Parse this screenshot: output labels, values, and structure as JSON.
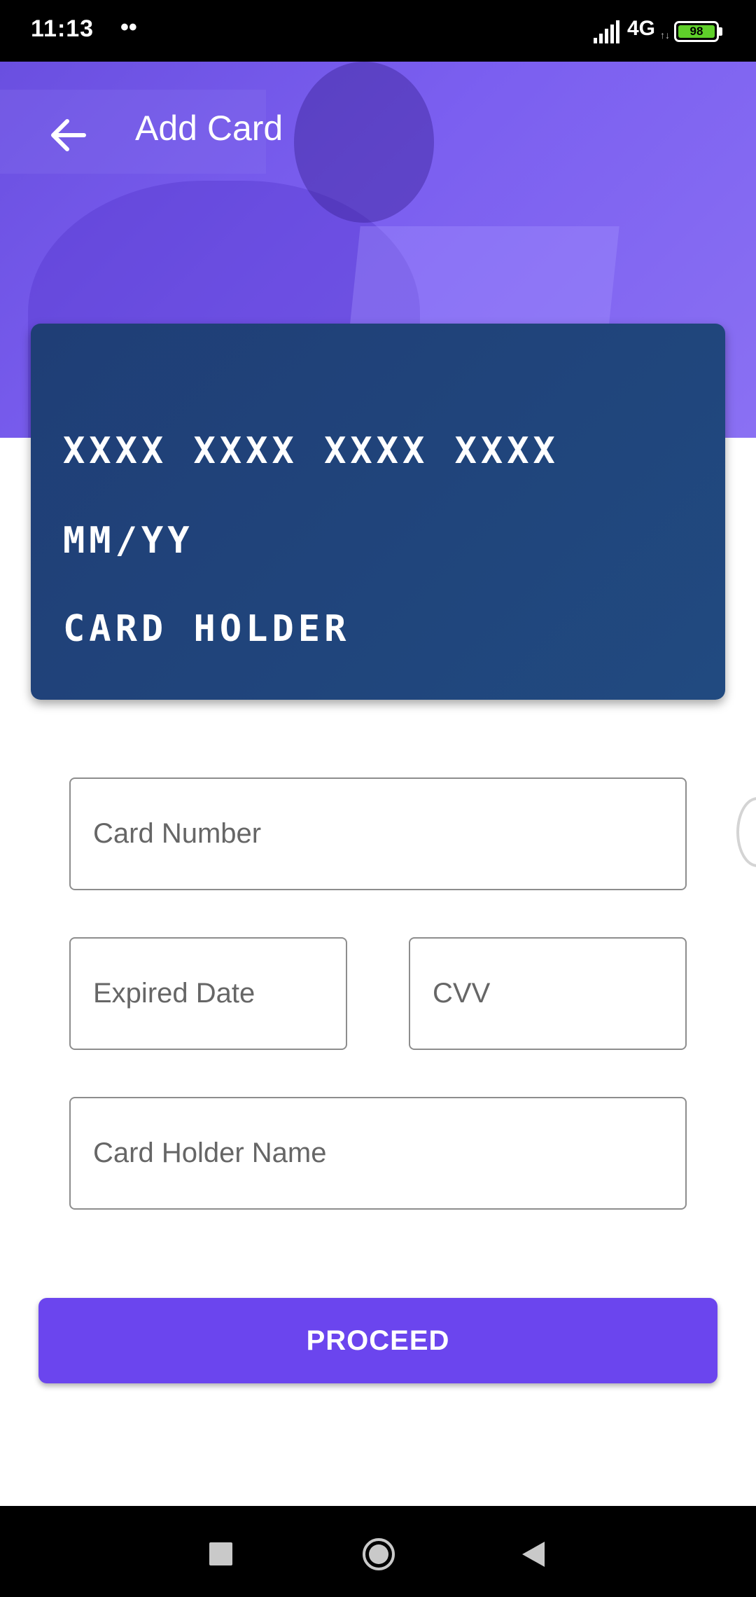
{
  "status_bar": {
    "time": "11:13",
    "dots": "••",
    "network": "4G",
    "network_sub": "↑↓",
    "battery": "98"
  },
  "header": {
    "title": "Add Card",
    "back_icon": "arrow-left-icon"
  },
  "card_preview": {
    "number": "XXXX XXXX XXXX XXXX",
    "expiry": "MM/YY",
    "holder": "CARD HOLDER"
  },
  "form": {
    "card_number_placeholder": "Card Number",
    "expired_date_placeholder": "Expired Date",
    "cvv_placeholder": "CVV",
    "card_holder_name_placeholder": "Card Holder Name"
  },
  "actions": {
    "proceed_label": "PROCEED"
  },
  "nav": {
    "recents_icon": "square-icon",
    "home_icon": "circle-home-icon",
    "back_icon": "triangle-back-icon"
  },
  "colors": {
    "header": "#7b5ff0",
    "card": "#1f4279",
    "button": "#6b45ee"
  }
}
